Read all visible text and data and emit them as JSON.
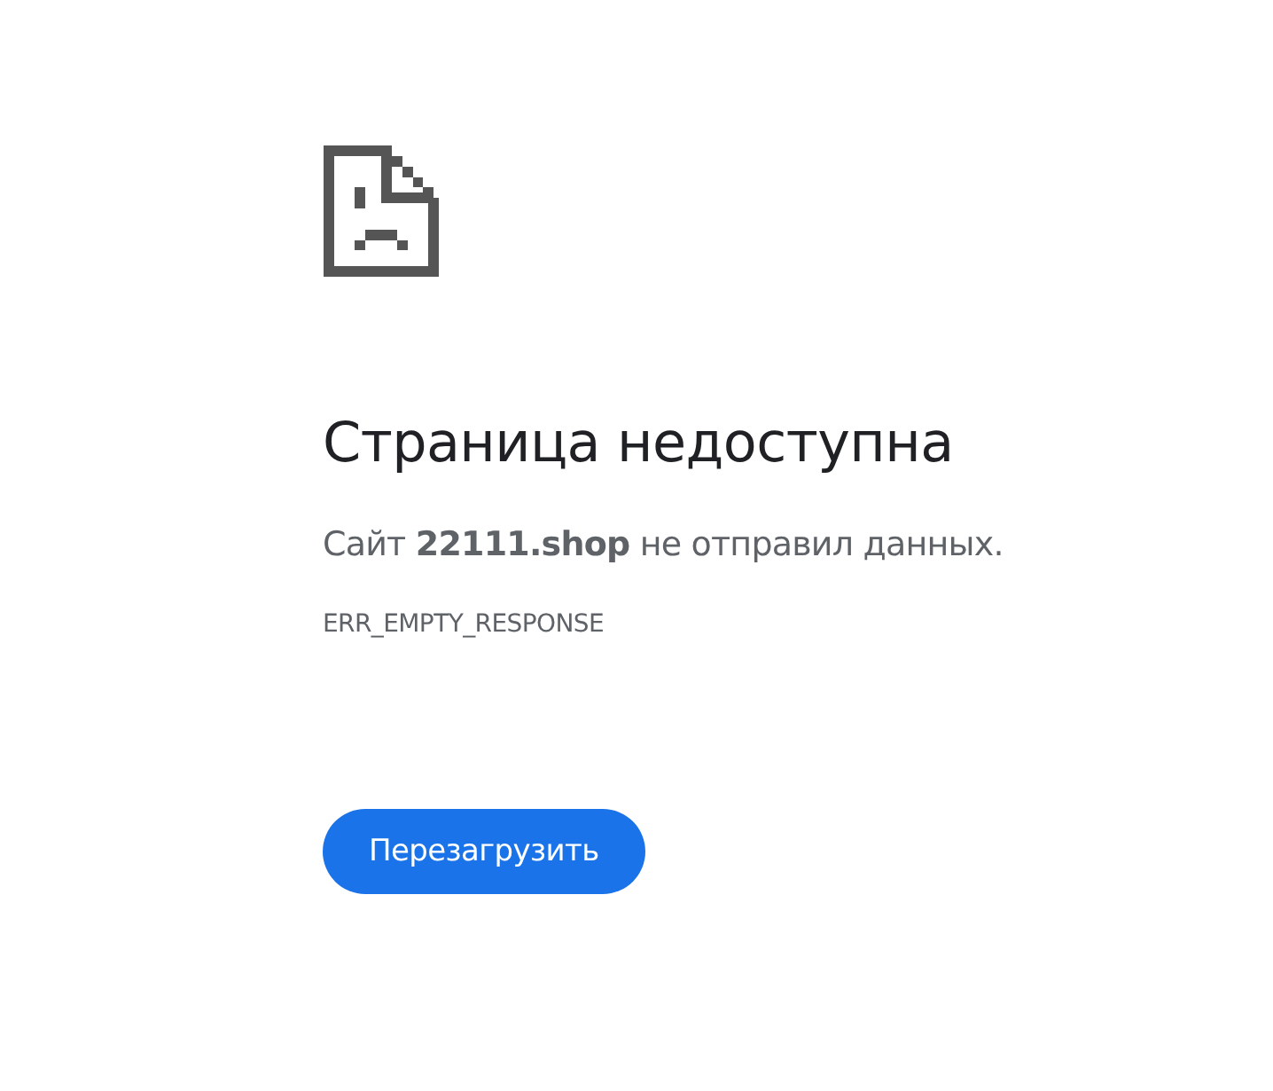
{
  "title": "Страница недоступна",
  "message": "Сайт **22111.shop** не отправил данных.",
  "error_code": "ERR_EMPTY_RESPONSE",
  "buttons": [
    "Перезагрузить"
  ]
}
